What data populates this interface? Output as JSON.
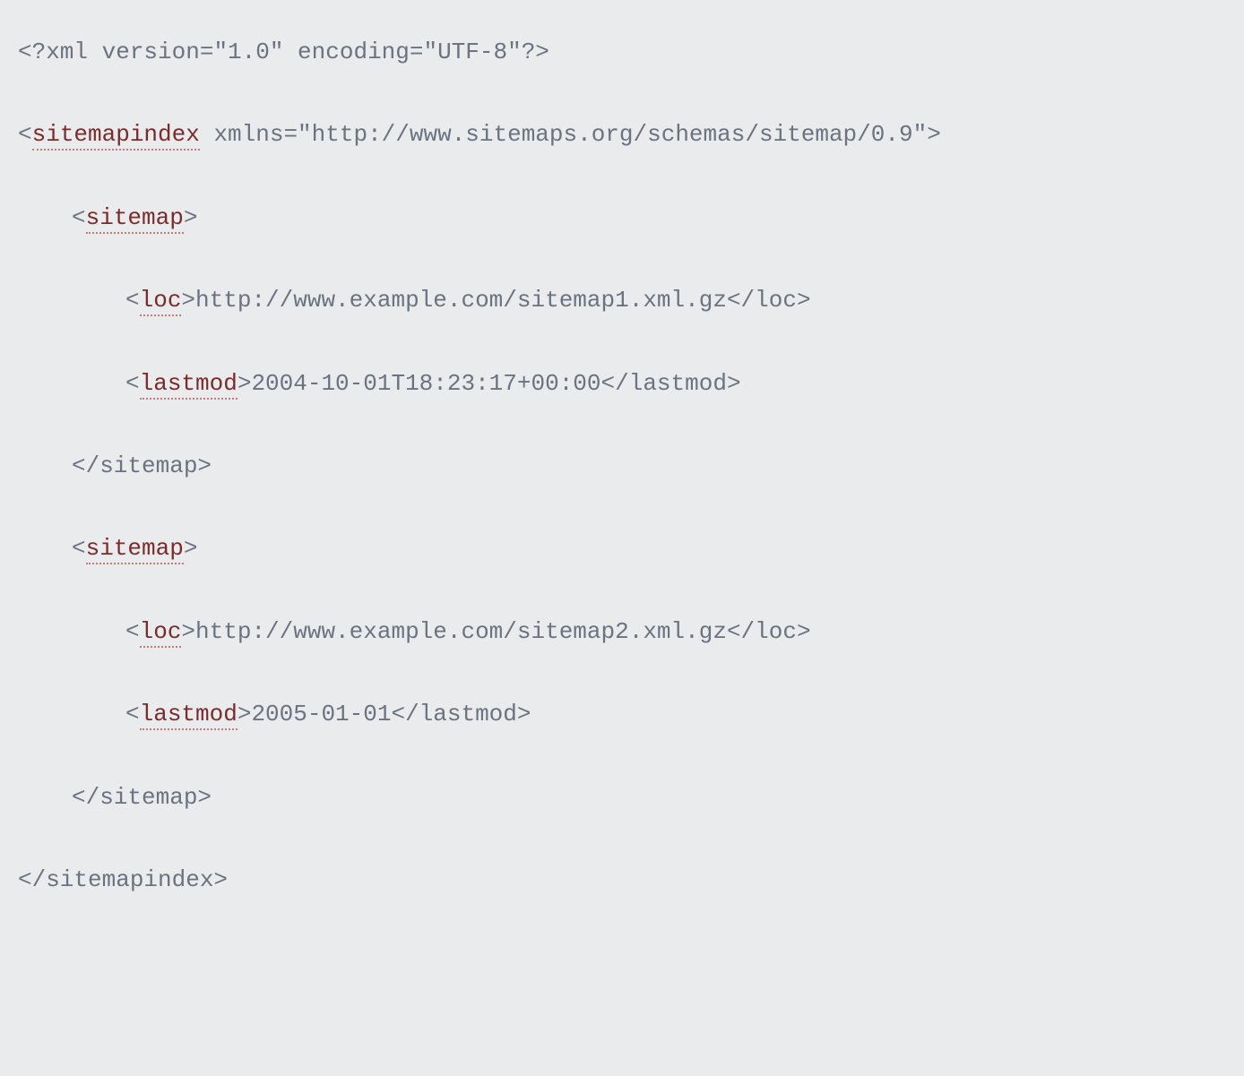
{
  "xml_declaration": {
    "open": "<?xml",
    "version_attr": " version=\"1.0\"",
    "encoding_attr": " encoding=\"UTF-8\"",
    "close": "?>"
  },
  "root": {
    "open_bracket": "<",
    "tag": "sitemapindex",
    "xmlns_attr": " xmlns=\"http://www.sitemaps.org/schemas/sitemap/0.9\"",
    "close_bracket": ">",
    "close_open": "</sitemapindex>"
  },
  "sitemap": {
    "open_bracket": "<",
    "tag": "sitemap",
    "close_bracket": ">",
    "close": "</sitemap>"
  },
  "loc": {
    "open_bracket": "<",
    "tag": "loc",
    "close_bracket": ">",
    "close": "</loc>"
  },
  "lastmod": {
    "open_bracket": "<",
    "tag": "lastmod",
    "close_bracket": ">",
    "close": "</lastmod>"
  },
  "entries": [
    {
      "loc": "http://www.example.com/sitemap1.xml.gz",
      "lastmod": "2004-10-01T18:23:17+00:00"
    },
    {
      "loc": "http://www.example.com/sitemap2.xml.gz",
      "lastmod": "2005-01-01"
    }
  ]
}
